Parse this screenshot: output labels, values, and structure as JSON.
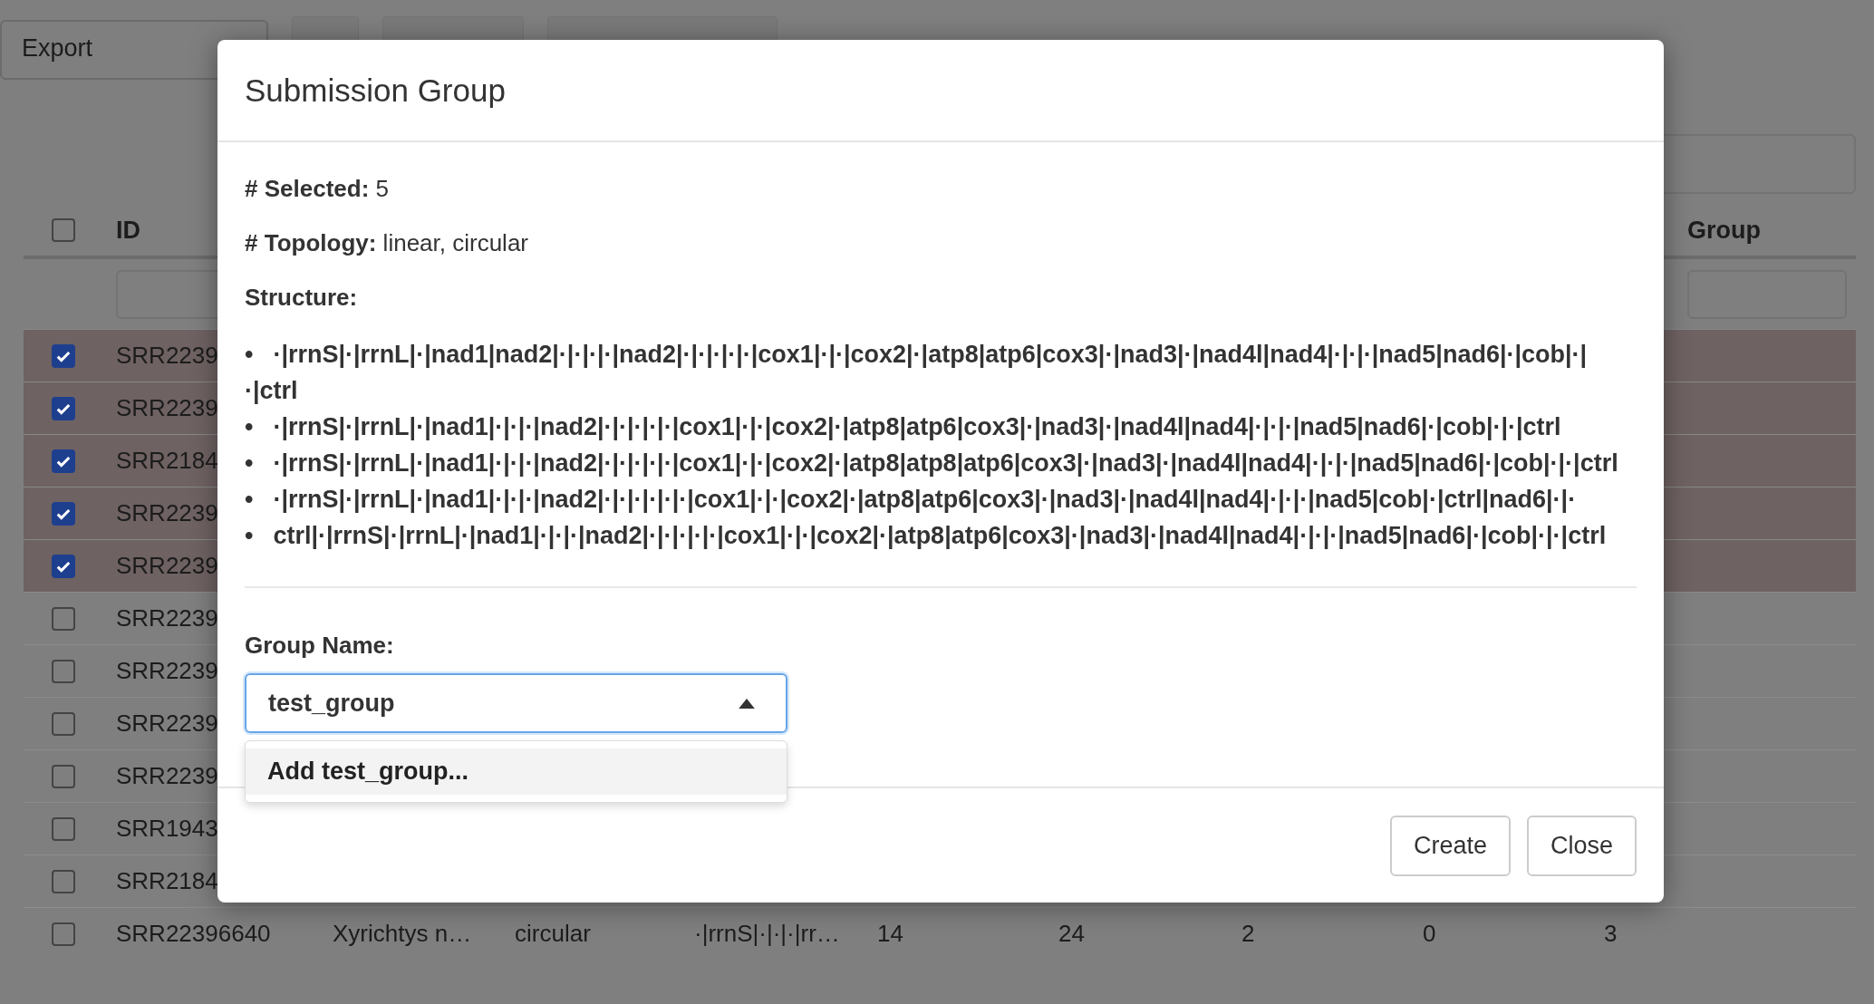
{
  "toolbar": {
    "export_select": {
      "value": "Export"
    }
  },
  "table": {
    "header": {
      "select_all_checked": false,
      "id_label": "ID",
      "group_label": "Group"
    },
    "rows": [
      {
        "selected": true,
        "cells": [
          "SRR2239"
        ]
      },
      {
        "selected": true,
        "cells": [
          "SRR2239"
        ]
      },
      {
        "selected": true,
        "cells": [
          "SRR2184"
        ]
      },
      {
        "selected": true,
        "cells": [
          "SRR2239"
        ]
      },
      {
        "selected": true,
        "cells": [
          "SRR2239"
        ]
      },
      {
        "selected": false,
        "cells": [
          "SRR2239"
        ]
      },
      {
        "selected": false,
        "cells": [
          "SRR2239"
        ]
      },
      {
        "selected": false,
        "cells": [
          "SRR2239"
        ]
      },
      {
        "selected": false,
        "cells": [
          "SRR2239"
        ]
      },
      {
        "selected": false,
        "cells": [
          "SRR1943"
        ]
      },
      {
        "selected": false,
        "cells": [
          "SRR2184"
        ]
      },
      {
        "selected": false,
        "cells": [
          "SRR22396640",
          "Xyrichtys n…",
          "circular",
          "·|rrnS|·|·|·|rr…",
          "14",
          "24",
          "2",
          "0",
          "3"
        ]
      }
    ]
  },
  "modal": {
    "title": "Submission Group",
    "summary": [
      "**# Selected:** 5",
      "**# Topology:** linear, circular"
    ],
    "structure_label": "Structure:",
    "bullet": "•",
    "structures": [
      "·|rrnS|·|rrnL|·|nad1|nad2|·|·|·|·|nad2|·|·|·|·|·|cox1|·|·|cox2|·|atp8|atp6|cox3|·|nad3|·|nad4l|nad4|·|·|·|nad5|nad6|·|cob|·|·|ctrl",
      "·|rrnS|·|rrnL|·|nad1|·|·|·|nad2|·|·|·|·|·|cox1|·|·|cox2|·|atp8|atp6|cox3|·|nad3|·|nad4l|nad4|·|·|·|nad5|nad6|·|cob|·|·|ctrl",
      "·|rrnS|·|rrnL|·|nad1|·|·|·|nad2|·|·|·|·|·|cox1|·|·|cox2|·|atp8|atp8|atp6|cox3|·|nad3|·|nad4l|nad4|·|·|·|nad5|nad6|·|cob|·|·|ctrl",
      "·|rrnS|·|rrnL|·|nad1|·|·|·|nad2|·|·|·|·|·|·|cox1|·|·|cox2|·|atp8|atp6|cox3|·|nad3|·|nad4l|nad4|·|·|·|nad5|cob|·|ctrl|nad6|·|·",
      "ctrl|·|rrnS|·|rrnL|·|nad1|·|·|·|nad2|·|·|·|·|·|cox1|·|·|cox2|·|atp8|atp6|cox3|·|nad3|·|nad4l|nad4|·|·|·|nad5|nad6|·|cob|·|·|ctrl"
    ],
    "group_name": {
      "label": "Group Name:",
      "value": "test_group",
      "expanded": true,
      "options": [
        {
          "label": "Add test_group...",
          "selected": true
        }
      ]
    },
    "buttons": [
      {
        "label": "Create"
      },
      {
        "label": "Close"
      }
    ]
  }
}
